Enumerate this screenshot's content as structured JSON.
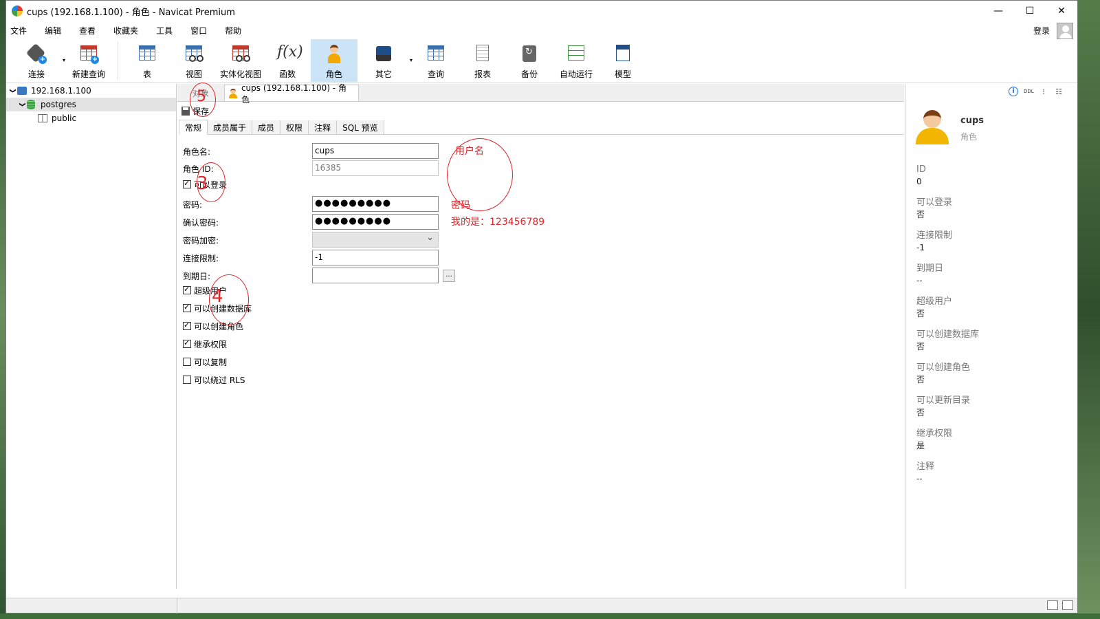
{
  "window": {
    "title": "cups (192.168.1.100) - 角色 - Navicat Premium"
  },
  "window_controls": {
    "minimize": "—",
    "maximize": "☐",
    "close": "✕"
  },
  "menu": [
    "文件",
    "编辑",
    "查看",
    "收藏夹",
    "工具",
    "窗口",
    "帮助"
  ],
  "login_label": "登录",
  "toolbar": {
    "connect": "连接",
    "new_query": "新建查询",
    "table": "表",
    "view": "视图",
    "materialized_view": "实体化视图",
    "function": "函数",
    "role": "角色",
    "other": "其它",
    "query": "查询",
    "report": "报表",
    "backup": "备份",
    "automation": "自动运行",
    "model": "模型",
    "fx_glyph": "f(x)",
    "dropdown_glyph": "▾"
  },
  "tree": {
    "server": "192.168.1.100",
    "database": "postgres",
    "schema": "public",
    "expand_glyph": "❯"
  },
  "tabs": {
    "objects": "对象",
    "active": "cups (192.168.1.100) - 角色"
  },
  "save_label": "保存",
  "subtabs": [
    "常规",
    "成员属于",
    "成员",
    "权限",
    "注释",
    "SQL 预览"
  ],
  "form": {
    "role_name_label": "角色名:",
    "role_name": "cups",
    "role_id_label": "角色 ID:",
    "role_id": "16385",
    "can_login_label": "可以登录",
    "password_label": "密码:",
    "password": "●●●●●●●●●",
    "confirm_label": "确认密码:",
    "confirm": "●●●●●●●●●",
    "encrypt_label": "密码加密:",
    "encrypt": "",
    "conn_limit_label": "连接限制:",
    "conn_limit": "-1",
    "expiry_label": "到期日:",
    "expiry": "",
    "expiry_btn": "...",
    "superuser_label": "超级用户",
    "create_db_label": "可以创建数据库",
    "create_role_label": "可以创建角色",
    "inherit_label": "继承权限",
    "replication_label": "可以复制",
    "bypass_rls_label": "可以绕过 RLS"
  },
  "checkboxes": {
    "can_login": true,
    "superuser": true,
    "create_db": true,
    "create_role": true,
    "inherit": true,
    "replication": false,
    "bypass_rls": false
  },
  "annotations": {
    "username": "用户名",
    "password": "密码",
    "my_password": "我的是：123456789",
    "n1": "5",
    "n2": "3",
    "n3": "4"
  },
  "right_panel": {
    "icons": {
      "info": "i",
      "ddl": "DDL",
      "deps": "⁝",
      "detail": "☷"
    },
    "name": "cups",
    "type": "角色",
    "props": [
      {
        "k": "ID",
        "v": "0"
      },
      {
        "k": "可以登录",
        "v": "否"
      },
      {
        "k": "连接限制",
        "v": "-1"
      },
      {
        "k": "到期日",
        "v": "--"
      },
      {
        "k": "超级用户",
        "v": "否"
      },
      {
        "k": "可以创建数据库",
        "v": "否"
      },
      {
        "k": "可以创建角色",
        "v": "否"
      },
      {
        "k": "可以更新目录",
        "v": "否"
      },
      {
        "k": "继承权限",
        "v": "是"
      },
      {
        "k": "注释",
        "v": "--"
      }
    ]
  },
  "colors": {
    "annotation": "#e0242a",
    "active_tool": "#cce4f7"
  }
}
